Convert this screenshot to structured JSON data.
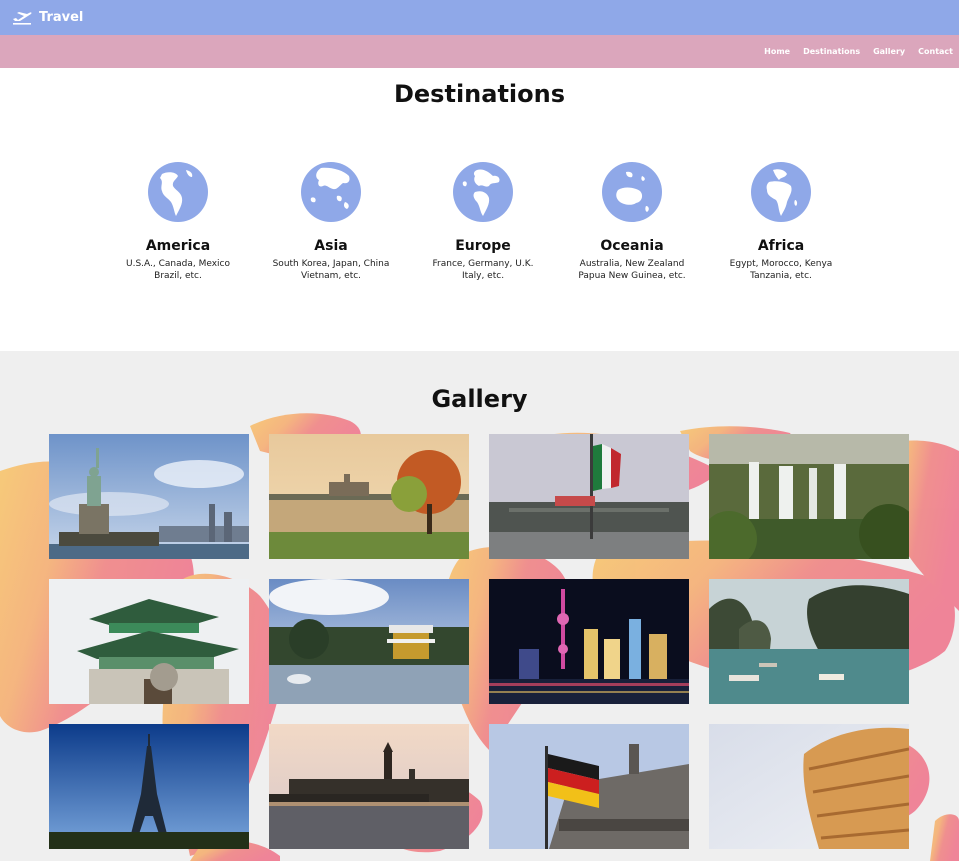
{
  "header": {
    "brand": "Travel",
    "brand_icon": "airplane-takeoff-icon"
  },
  "nav": {
    "items": [
      "Home",
      "Destinations",
      "Gallery",
      "Contact"
    ]
  },
  "destinations": {
    "title": "Destinations",
    "items": [
      {
        "name": "America",
        "line1": "U.S.A., Canada, Mexico",
        "line2": "Brazil, etc.",
        "icon": "globe-americas-icon"
      },
      {
        "name": "Asia",
        "line1": "South Korea, Japan, China",
        "line2": "Vietnam, etc.",
        "icon": "globe-asia-icon"
      },
      {
        "name": "Europe",
        "line1": "France, Germany, U.K.",
        "line2": "Italy, etc.",
        "icon": "globe-europe-icon"
      },
      {
        "name": "Oceania",
        "line1": "Australia, New Zealand",
        "line2": "Papua New Guinea, etc.",
        "icon": "globe-oceania-icon"
      },
      {
        "name": "Africa",
        "line1": "Egypt, Morocco, Kenya",
        "line2": "Tanzania, etc.",
        "icon": "globe-africa-icon"
      }
    ]
  },
  "gallery": {
    "title": "Gallery",
    "photos": [
      "statue-of-liberty",
      "lake-castle-autumn",
      "mexico-flag-plaza",
      "waterfalls",
      "korean-palace-gate",
      "golden-pavilion-snow",
      "shanghai-skyline-night",
      "ha-long-bay",
      "eiffel-tower",
      "london-parliament-bridge",
      "germany-flag-reichstag",
      "leaning-tower-pisa"
    ]
  },
  "colors": {
    "accent_blue": "#8fa8e8",
    "accent_pink": "#dba6bc",
    "gallery_bg": "#efefef"
  }
}
